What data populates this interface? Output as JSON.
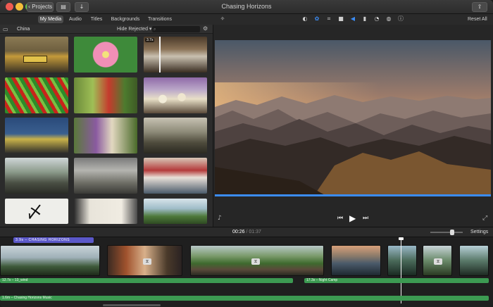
{
  "window": {
    "title": "Chasing Horizons",
    "projects_label": "Projects"
  },
  "tabs": [
    {
      "label": "My Media",
      "active": true
    },
    {
      "label": "Audio",
      "active": false
    },
    {
      "label": "Titles",
      "active": false
    },
    {
      "label": "Backgrounds",
      "active": false
    },
    {
      "label": "Transitions",
      "active": false
    }
  ],
  "toolbar": {
    "reset_all": "Reset All"
  },
  "browser": {
    "album_name": "China",
    "filter_label": "Hide Rejected",
    "thumb_badge": "3.7s"
  },
  "viewer": {
    "timecode_current": "00:26",
    "timecode_sep": "/",
    "timecode_total": "01:37",
    "settings_label": "Settings"
  },
  "timeline": {
    "title_clip_label": "3.9s – CHASING HORIZONS",
    "audio_clip_1": "12.7s – 13_wind",
    "audio_clip_2": "17.3s – Night Camp",
    "music_track": "1.6m – Chasing Horizons Music"
  },
  "colors": {
    "accent_blue": "#3b8cf5",
    "audio_green": "#3c9a52",
    "title_purple": "#5b58c9"
  }
}
